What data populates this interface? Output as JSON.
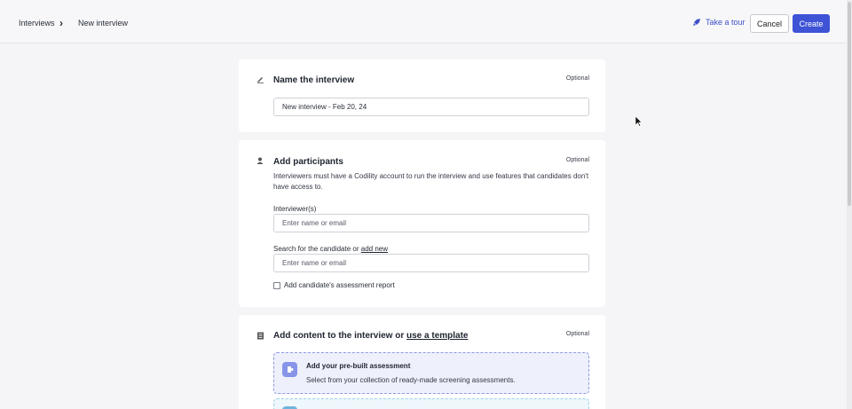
{
  "header": {
    "breadcrumb": [
      "Interviews",
      "New interview"
    ],
    "breadcrumb_separator": "›",
    "tour_label": "Take a tour",
    "cancel_label": "Cancel",
    "create_label": "Create"
  },
  "name_section": {
    "title": "Name the interview",
    "optional": "Optional",
    "name_value": "New interview - Feb 20, 24",
    "icon": "pencil-icon"
  },
  "participants_section": {
    "title": "Add participants",
    "optional": "Optional",
    "description": "Interviewers must have a Codility account to run the interview and use features that candidates don't have access to.",
    "interviewers_label": "Interviewer(s)",
    "interviewers_placeholder": "Enter name or email",
    "candidate_label": "Search for the candidate or",
    "candidate_link": "add new",
    "candidate_placeholder": "Enter name or email",
    "report_checkbox_label": "Add candidate's assessment report",
    "report_checked": false,
    "icon": "users-icon"
  },
  "content_section": {
    "title": "Add content to the interview or",
    "template_link": "use a template",
    "optional": "Optional",
    "icon": "document-icon",
    "options": [
      {
        "title": "Add your pre-built assessment",
        "description": "Select from your collection of ready-made screening assessments."
      }
    ]
  },
  "colors": {
    "accent": "#3e53d6",
    "link": "#3c4fc7"
  }
}
